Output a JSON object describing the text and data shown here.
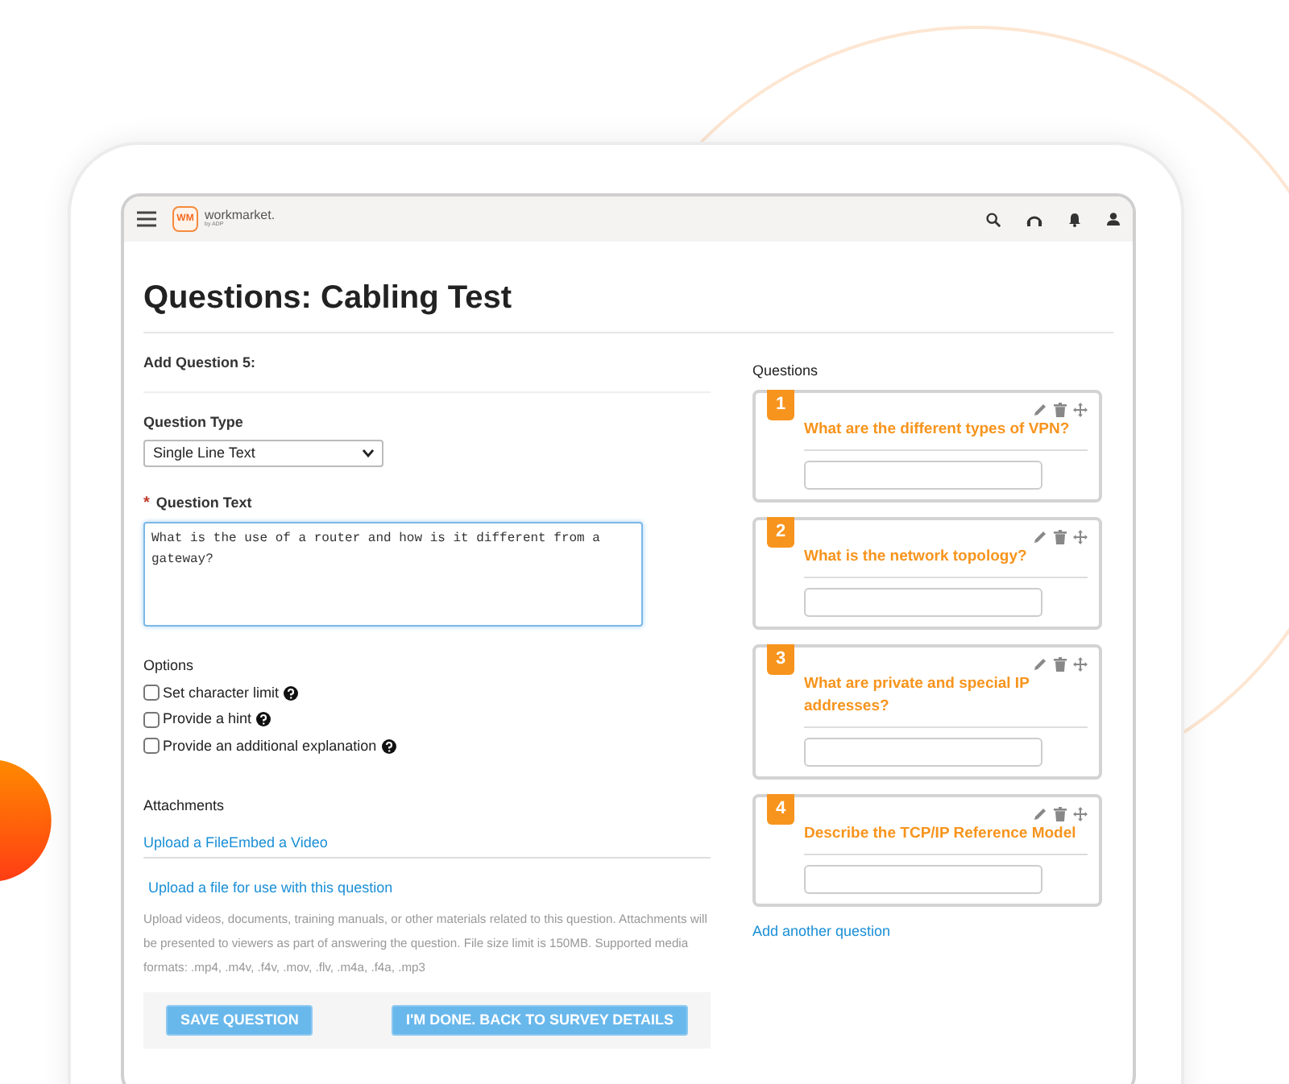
{
  "header": {
    "logo_mark": "WM",
    "logo_text": "workmarket.",
    "logo_sub": "by ADP"
  },
  "page_title": "Questions: Cabling Test",
  "form": {
    "heading": "Add Question 5:",
    "question_type": {
      "label": "Question Type",
      "value": "Single Line Text"
    },
    "question_text": {
      "required_mark": "*",
      "label": "Question Text",
      "value": "What is the use of a router and how is it different from a gateway?"
    },
    "options": {
      "label": "Options",
      "items": [
        {
          "label": "Set character limit",
          "checked": false
        },
        {
          "label": "Provide a hint",
          "checked": false
        },
        {
          "label": "Provide an additional explanation",
          "checked": false
        }
      ]
    },
    "attachments": {
      "label": "Attachments",
      "tabs": [
        "Upload a File",
        "Embed a Video"
      ],
      "upload_link": "Upload a file for use with this question",
      "help_text": "Upload videos, documents, training manuals, or other materials related to this question. Attachments will be presented to viewers as part of answering the question. File size limit is 150MB. Supported media formats: .mp4, .m4v, .f4v, .mov, .flv, .m4a, .f4a, .mp3"
    },
    "buttons": [
      "SAVE QUESTION",
      "I'M DONE. BACK TO SURVEY DETAILS"
    ]
  },
  "questions_panel": {
    "heading": "Questions",
    "items": [
      {
        "number": "1",
        "text": "What are the different types of VPN?"
      },
      {
        "number": "2",
        "text": "What is the network topology?"
      },
      {
        "number": "3",
        "text": "What are private and special IP addresses?"
      },
      {
        "number": "4",
        "text": "Describe the TCP/IP Reference Model"
      }
    ],
    "add_link": "Add another question"
  }
}
